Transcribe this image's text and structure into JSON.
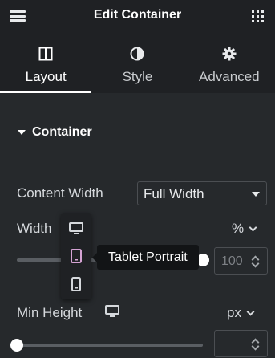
{
  "header": {
    "title": "Edit Container",
    "menu_icon": "hamburger-icon",
    "apps_icon": "grid-icon"
  },
  "tabs": [
    {
      "label": "Layout",
      "icon": "columns-icon",
      "active": true
    },
    {
      "label": "Style",
      "icon": "half-circle-icon",
      "active": false
    },
    {
      "label": "Advanced",
      "icon": "gear-icon",
      "active": false
    }
  ],
  "section": {
    "title": "Container"
  },
  "content_width": {
    "label": "Content Width",
    "value": "Full Width"
  },
  "width": {
    "label": "Width",
    "unit": "%",
    "value": "100",
    "slider_fraction": 1.0
  },
  "device_switcher": {
    "options": [
      {
        "name": "Desktop",
        "icon": "monitor-icon"
      },
      {
        "name": "Tablet Portrait",
        "icon": "tablet-icon",
        "active": true
      },
      {
        "name": "Mobile Portrait",
        "icon": "mobile-icon"
      }
    ],
    "tooltip": "Tablet Portrait"
  },
  "min_height": {
    "label": "Min Height",
    "unit": "px",
    "value": "",
    "slider_fraction": 0.0
  },
  "colors": {
    "panel_bg": "#26292c",
    "header_bg": "#1f2124",
    "tooltip_bg": "#121416",
    "active_accent": "#ffffff",
    "device_active": "#d5a3d4"
  }
}
